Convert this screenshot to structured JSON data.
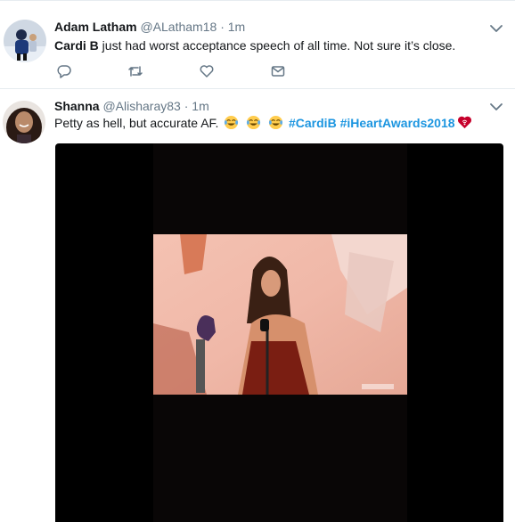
{
  "tweets": [
    {
      "name": "Adam Latham",
      "handle": "@ALatham18",
      "separator": "·",
      "time": "1m",
      "text_bold": "Cardi B",
      "text_rest": " just had worst acceptance speech of all time. Not sure it’s close.",
      "actions": [
        "reply-icon",
        "retweet-icon",
        "like-icon",
        "direct-message-icon"
      ]
    },
    {
      "name": "Shanna",
      "handle": "@Alisharay83",
      "separator": "·",
      "time": "1m",
      "text": "Petty as hell, but accurate AF.",
      "hashtags": [
        "#CardiB",
        "#iHeartAwards2018"
      ],
      "emojis": [
        "laughing-crying-emoji",
        "laughing-crying-emoji",
        "laughing-crying-emoji",
        "iheart-logo-emoji"
      ]
    }
  ],
  "colors": {
    "link": "#1b95e0",
    "secondary_text": "#657786",
    "border": "#e6ecf0"
  }
}
